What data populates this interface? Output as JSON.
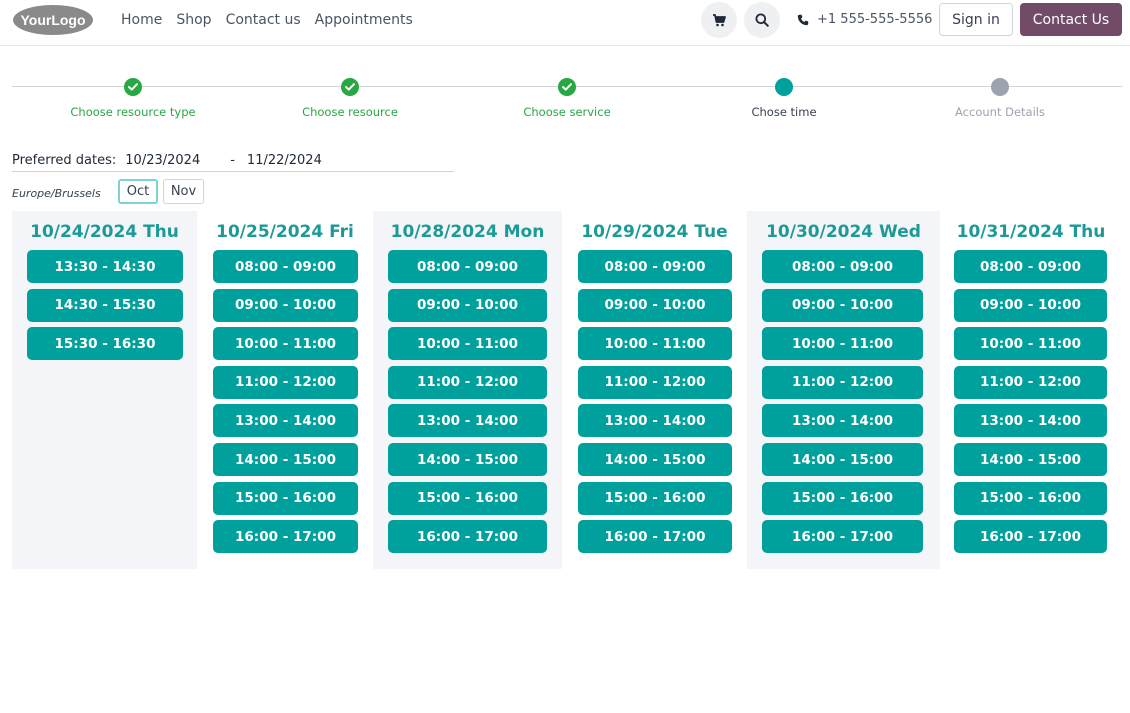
{
  "header": {
    "logo_text": "YourLogo",
    "nav": [
      {
        "label": "Home"
      },
      {
        "label": "Shop"
      },
      {
        "label": "Contact us"
      },
      {
        "label": "Appointments"
      }
    ],
    "phone": "+1 555-555-5556",
    "sign_in": "Sign in",
    "contact_us": "Contact Us"
  },
  "stepper": {
    "steps": [
      {
        "label": "Choose resource type",
        "state": "done"
      },
      {
        "label": "Choose resource",
        "state": "done"
      },
      {
        "label": "Choose service",
        "state": "done"
      },
      {
        "label": "Chose time",
        "state": "current"
      },
      {
        "label": "Account Details",
        "state": "todo"
      }
    ]
  },
  "dates": {
    "label": "Preferred dates:",
    "start": "10/23/2024",
    "separator": "-",
    "end": "11/22/2024"
  },
  "timezone": "Europe/Brussels",
  "months": [
    {
      "label": "Oct",
      "active": true
    },
    {
      "label": "Nov",
      "active": false
    }
  ],
  "days": [
    {
      "title": "10/24/2024 Thu",
      "slots": [
        "13:30 - 14:30",
        "14:30 - 15:30",
        "15:30 - 16:30"
      ]
    },
    {
      "title": "10/25/2024 Fri",
      "slots": [
        "08:00 - 09:00",
        "09:00 - 10:00",
        "10:00 - 11:00",
        "11:00 - 12:00",
        "13:00 - 14:00",
        "14:00 - 15:00",
        "15:00 - 16:00",
        "16:00 - 17:00"
      ]
    },
    {
      "title": "10/28/2024 Mon",
      "slots": [
        "08:00 - 09:00",
        "09:00 - 10:00",
        "10:00 - 11:00",
        "11:00 - 12:00",
        "13:00 - 14:00",
        "14:00 - 15:00",
        "15:00 - 16:00",
        "16:00 - 17:00"
      ]
    },
    {
      "title": "10/29/2024 Tue",
      "slots": [
        "08:00 - 09:00",
        "09:00 - 10:00",
        "10:00 - 11:00",
        "11:00 - 12:00",
        "13:00 - 14:00",
        "14:00 - 15:00",
        "15:00 - 16:00",
        "16:00 - 17:00"
      ]
    },
    {
      "title": "10/30/2024 Wed",
      "slots": [
        "08:00 - 09:00",
        "09:00 - 10:00",
        "10:00 - 11:00",
        "11:00 - 12:00",
        "13:00 - 14:00",
        "14:00 - 15:00",
        "15:00 - 16:00",
        "16:00 - 17:00"
      ]
    },
    {
      "title": "10/31/2024 Thu",
      "slots": [
        "08:00 - 09:00",
        "09:00 - 10:00",
        "10:00 - 11:00",
        "11:00 - 12:00",
        "13:00 - 14:00",
        "14:00 - 15:00",
        "15:00 - 16:00",
        "16:00 - 17:00"
      ]
    }
  ],
  "colors": {
    "accent": "#00a09d",
    "accent_text": "#1d9a96",
    "brand": "#714b67",
    "done": "#28a745"
  },
  "icons": {
    "cart": "cart-icon",
    "search": "search-icon",
    "phone": "phone-icon",
    "check": "check-icon"
  }
}
